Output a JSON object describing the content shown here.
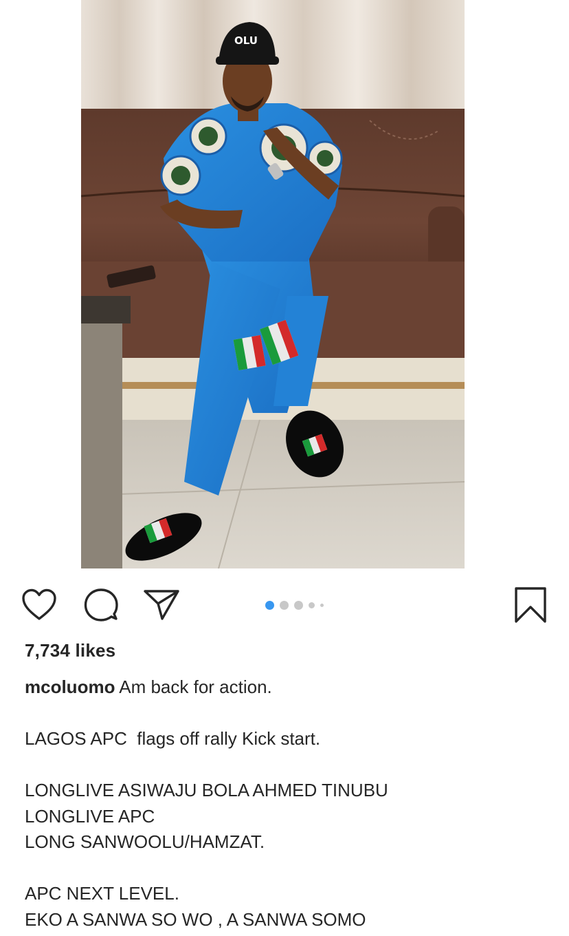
{
  "post": {
    "image_alt": "Man in blue APC attire seated on a brown leather sofa",
    "carousel": {
      "total": 5,
      "active": 1
    },
    "actions": {
      "like_icon": "heart-icon",
      "comment_icon": "comment-icon",
      "share_icon": "send-icon",
      "save_icon": "bookmark-icon"
    },
    "likes": "7,734 likes",
    "caption": {
      "username": "mcoluomo",
      "first_line": " Am back for action.",
      "lines": [
        "",
        "LAGOS APC  flags off rally Kick start.",
        "",
        "LONGLIVE ASIWAJU BOLA AHMED TINUBU",
        "LONGLIVE APC",
        "LONG SANWOOLU/HAMZAT.",
        "",
        "APC NEXT LEVEL.",
        "EKO A SANWA SO WO , A SANWA SOMO"
      ]
    }
  },
  "colors": {
    "text": "#262626",
    "dot_active": "#3897f0",
    "dot_inactive": "#c8c8c8"
  }
}
